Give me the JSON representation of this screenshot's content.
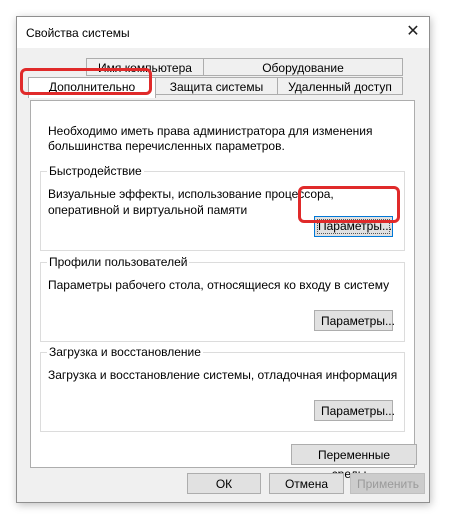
{
  "window": {
    "title": "Свойства системы",
    "close_label": "✕"
  },
  "tabs": {
    "row_back": [
      "Имя компьютера",
      "Оборудование"
    ],
    "row_front": [
      "Дополнительно",
      "Защита системы",
      "Удаленный доступ"
    ],
    "active": "Дополнительно"
  },
  "panel": {
    "admin_note": "Необходимо иметь права администратора для изменения большинства перечисленных параметров.",
    "performance": {
      "title": "Быстродействие",
      "description": "Визуальные эффекты, использование процессора, оперативной и виртуальной памяти",
      "button": "Параметры..."
    },
    "profiles": {
      "title": "Профили пользователей",
      "description": "Параметры рабочего стола, относящиеся ко входу в систему",
      "button": "Параметры..."
    },
    "startup": {
      "title": "Загрузка и восстановление",
      "description": "Загрузка и восстановление системы, отладочная информация",
      "button": "Параметры..."
    },
    "env_button": "Переменные среды..."
  },
  "footer": {
    "ok": "ОК",
    "cancel": "Отмена",
    "apply": "Применить"
  },
  "colors": {
    "highlight": "#e02a2a",
    "focus": "#0078d7"
  }
}
